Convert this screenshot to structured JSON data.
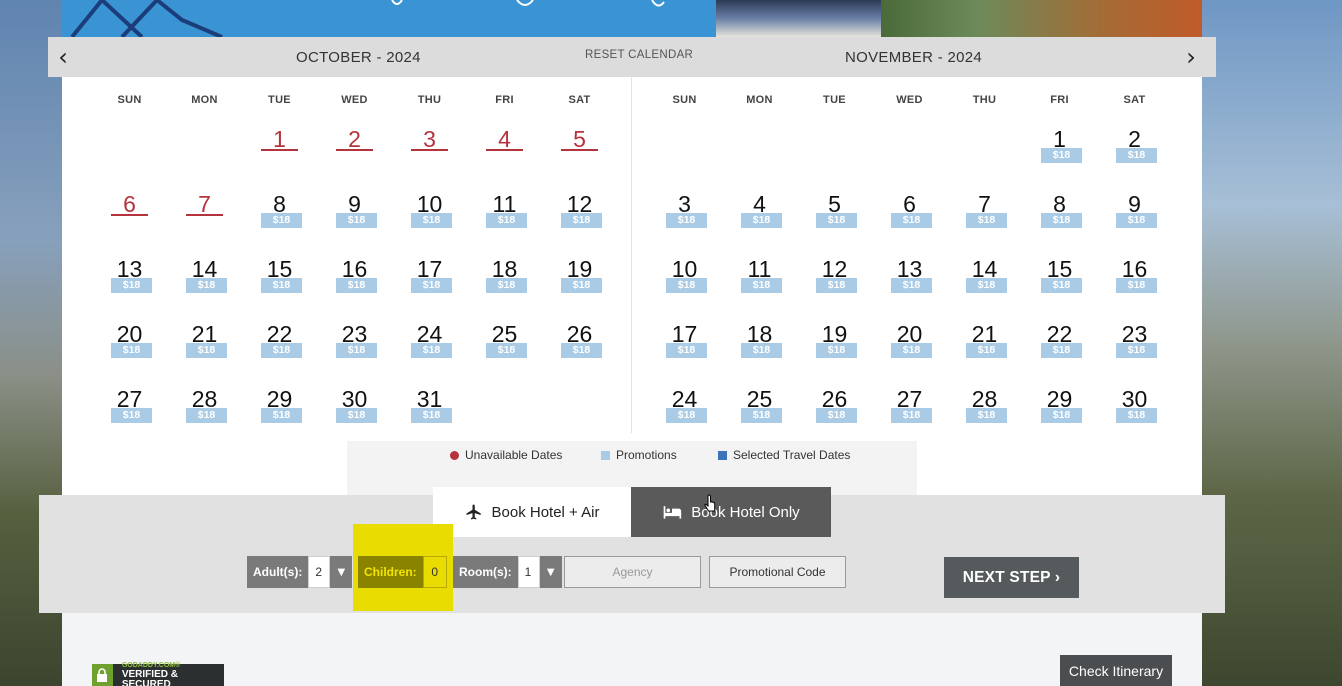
{
  "calendar": {
    "reset_label": "RESET CALENDAR",
    "prev_icon": "‹",
    "next_icon": "›",
    "weekday_labels": [
      "SUN",
      "MON",
      "TUE",
      "WED",
      "THU",
      "FRI",
      "SAT"
    ],
    "price_label": "$18",
    "months": [
      {
        "title": "OCTOBER - 2024",
        "first_weekday": 2,
        "days_in_month": 31,
        "unavailable": [
          1,
          2,
          3,
          4,
          5,
          6,
          7
        ]
      },
      {
        "title": "NOVEMBER - 2024",
        "first_weekday": 5,
        "days_in_month": 30,
        "unavailable": []
      }
    ]
  },
  "legend": {
    "unavailable": "Unavailable Dates",
    "promotions": "Promotions",
    "selected": "Selected Travel Dates",
    "colors": {
      "unavailable": "#b5333d",
      "promotions": "#a9cbe6",
      "selected": "#3c74b7"
    }
  },
  "booking": {
    "tab_air": "Book Hotel + Air",
    "tab_hotel": "Book Hotel Only",
    "active_tab": "hotel",
    "adults_label": "Adult(s):",
    "adults_value": "2",
    "children_label": "Children:",
    "children_value": "0",
    "rooms_label": "Room(s):",
    "rooms_value": "1",
    "agency_placeholder": "Agency",
    "promo_placeholder": "Promotional Code",
    "next_step": "NEXT STEP ›"
  },
  "footer": {
    "badge_brand": "GODADDY.COM®",
    "badge_text": "VERIFIED & SECURED",
    "check_itinerary": "Check Itinerary"
  }
}
